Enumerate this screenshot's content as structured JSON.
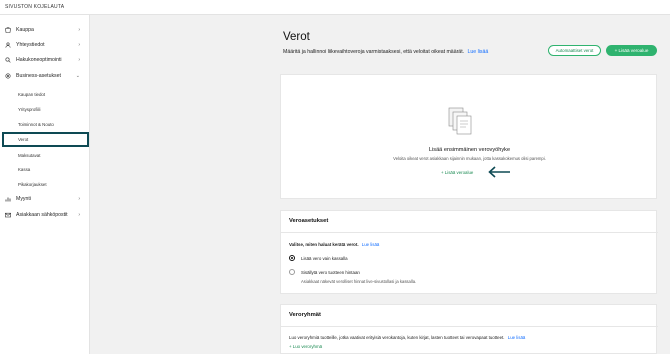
{
  "topbar": {
    "title": "SIVUSTON KOJELAUTA"
  },
  "sidebar": {
    "items": [
      {
        "label": "Kauppa",
        "icon": "store-icon",
        "chevron": "›"
      },
      {
        "label": "Yhteystiedot",
        "icon": "contacts-icon",
        "chevron": "›"
      },
      {
        "label": "Hakukoneoptimointi",
        "icon": "search-icon",
        "chevron": "›"
      },
      {
        "label": "Business-asetukset",
        "icon": "gear-icon",
        "chevron": "⌄"
      }
    ],
    "subitems": [
      {
        "label": "Kaupan tiedot"
      },
      {
        "label": "Yritysprofiili"
      },
      {
        "label": "Toiminnot & Nouto"
      },
      {
        "label": "Verot"
      },
      {
        "label": "Maksutavat"
      },
      {
        "label": "Kassa"
      },
      {
        "label": "Pikakorjaukset"
      }
    ],
    "bottom_items": [
      {
        "label": "Myynti",
        "icon": "chart-icon",
        "chevron": "›"
      },
      {
        "label": "Asiakkaan sähköpostit",
        "icon": "mail-icon",
        "chevron": "›"
      }
    ]
  },
  "header": {
    "title": "Verot",
    "description": "Määritä ja hallinnoi liikevaihtoveroja varmistaaksesi, että veloitat oikeat määrät.",
    "learn_more": "Lue lisää",
    "auto_tax_button": "Automaattiset verot",
    "add_region_button": "+ Lisää veroalue"
  },
  "empty_state": {
    "title": "Lisää ensimmäinen verovyöhyke",
    "description": "Veloita oikeat verot asiakkaan sijainnin mukaan, jotta kassakokemus olisi parempi.",
    "add_link": "+ Lisää veroalue"
  },
  "tax_settings": {
    "heading": "Veroasetukset",
    "intro": "Valitse, miten haluat kerätä verot.",
    "learn_more": "Lue lisää",
    "options": [
      {
        "label": "Lisää vero vain kassalla",
        "selected": true
      },
      {
        "label": "Sisällytä vero tuotteen hintaan",
        "selected": false
      }
    ],
    "option2_help": "Asiakkaat näkevät verolliset hinnat live-sivustollasi ja kassalla."
  },
  "tax_groups": {
    "heading": "Veroryhmät",
    "intro": "Luo veroryhmiä tuotteille, jotka vaativat erityisiä verokantoja, kuten kirjat, lasten tuotteet tai verovapaat tuotteet.",
    "learn_more": "Lue lisää",
    "add_link": "+ Luo veroryhmä"
  },
  "colors": {
    "accent_green": "#2fb36f",
    "link_blue": "#116dff",
    "highlight": "#0e4a54"
  }
}
